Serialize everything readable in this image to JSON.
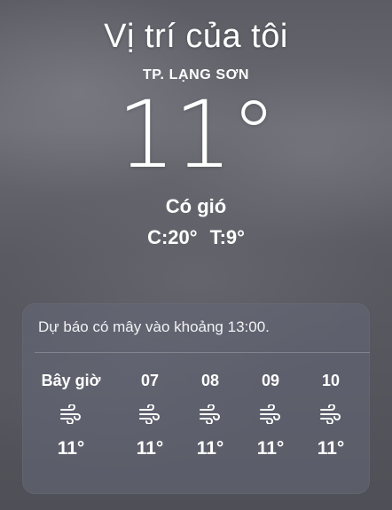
{
  "location": {
    "title": "Vị trí của tôi",
    "city": "TP. LẠNG SƠN"
  },
  "current": {
    "temperature": "11°",
    "condition": "Có gió",
    "high": "C:20°",
    "low": "T:9°"
  },
  "forecast": {
    "summary": "Dự báo có mây vào khoảng 13:00.",
    "hours": [
      {
        "label": "Bây giờ",
        "icon": "wind-icon",
        "temp": "11°"
      },
      {
        "label": "07",
        "icon": "wind-icon",
        "temp": "11°"
      },
      {
        "label": "08",
        "icon": "wind-icon",
        "temp": "11°"
      },
      {
        "label": "09",
        "icon": "wind-icon",
        "temp": "11°"
      },
      {
        "label": "10",
        "icon": "wind-icon",
        "temp": "11°"
      }
    ]
  }
}
